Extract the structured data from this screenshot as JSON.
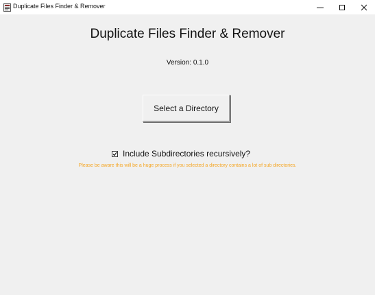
{
  "window": {
    "title": "Duplicate Files Finder & Remover",
    "icon": "app-window-icon",
    "controls": {
      "minimize_icon": "minimize-icon",
      "maximize_icon": "maximize-icon",
      "close_icon": "close-icon"
    }
  },
  "main": {
    "title": "Duplicate Files Finder & Remover",
    "version_text": "Version: 0.1.0",
    "select_button_label": "Select a Directory",
    "recursive_checkbox": {
      "label": "Include Subdirectories recursively?",
      "checked": true
    },
    "warning_text": "Please be aware this will be a huge process if you selected a directory contains a lot of sub directories."
  },
  "colors": {
    "background": "#f0f0f0",
    "titlebar": "#ffffff",
    "warning": "#f5a623",
    "text": "#111111"
  }
}
